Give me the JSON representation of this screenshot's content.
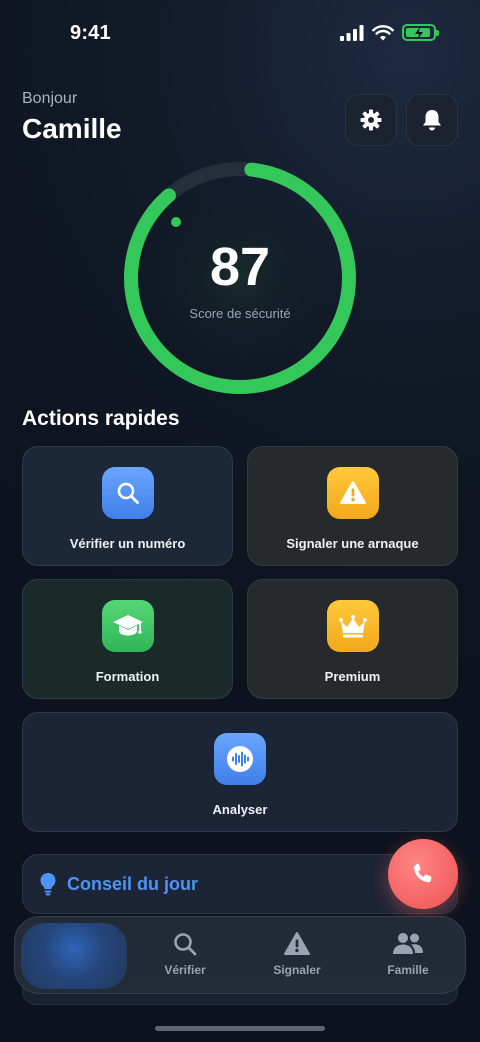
{
  "status_bar": {
    "time": "9:41"
  },
  "header": {
    "greeting": "Bonjour",
    "user_name": "Camille"
  },
  "score": {
    "value": "87",
    "label": "Score de sécurité",
    "fraction": 0.87,
    "color": "#34c759"
  },
  "quick_actions": {
    "title": "Actions rapides",
    "items": [
      {
        "label": "Vérifier un numéro",
        "icon": "search-icon"
      },
      {
        "label": "Signaler une arnaque",
        "icon": "warning-icon"
      },
      {
        "label": "Formation",
        "icon": "graduation-cap-icon"
      },
      {
        "label": "Premium",
        "icon": "crown-icon"
      },
      {
        "label": "Analyser",
        "icon": "waveform-icon"
      }
    ]
  },
  "tip": {
    "title": "Conseil du jour",
    "icon": "lightbulb-icon"
  },
  "fab": {
    "icon": "phone-icon",
    "color": "#ee5353"
  },
  "tab_bar": {
    "items": [
      {
        "label": "",
        "icon": "home-icon",
        "active": true
      },
      {
        "label": "Vérifier",
        "icon": "search-icon"
      },
      {
        "label": "Signaler",
        "icon": "warning-icon"
      },
      {
        "label": "Famille",
        "icon": "people-icon"
      }
    ]
  },
  "colors": {
    "accent_blue": "#4e94f5",
    "accent_green": "#34c759",
    "accent_amber": "#f2a81d"
  }
}
